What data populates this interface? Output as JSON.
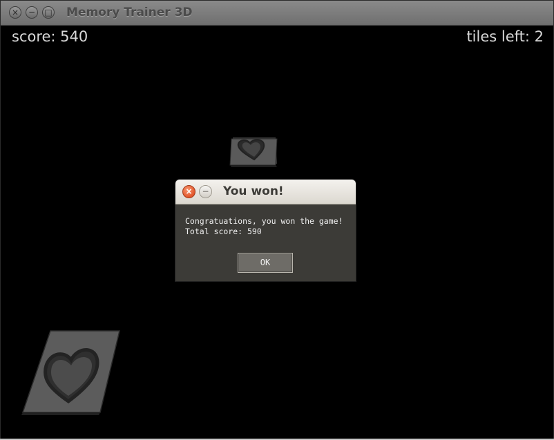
{
  "window": {
    "title": "Memory Trainer 3D",
    "close_glyph": "×",
    "minimize_glyph": "−",
    "maximize_glyph": "□"
  },
  "hud": {
    "score": "score: 540",
    "tiles_left": "tiles left: 2"
  },
  "tiles": [
    {
      "symbol": "heart-icon"
    },
    {
      "symbol": "heart-icon"
    }
  ],
  "dialog": {
    "title": "You won!",
    "close_glyph": "×",
    "minimize_glyph": "−",
    "message_line1": "Congratuations, you won the game!",
    "message_line2": "Total score: 590",
    "ok_label": "OK"
  },
  "colors": {
    "background": "#000000",
    "hud_text": "#d8d8d8",
    "dialog_body": "#3c3b37",
    "dialog_close": "#e2552a"
  }
}
